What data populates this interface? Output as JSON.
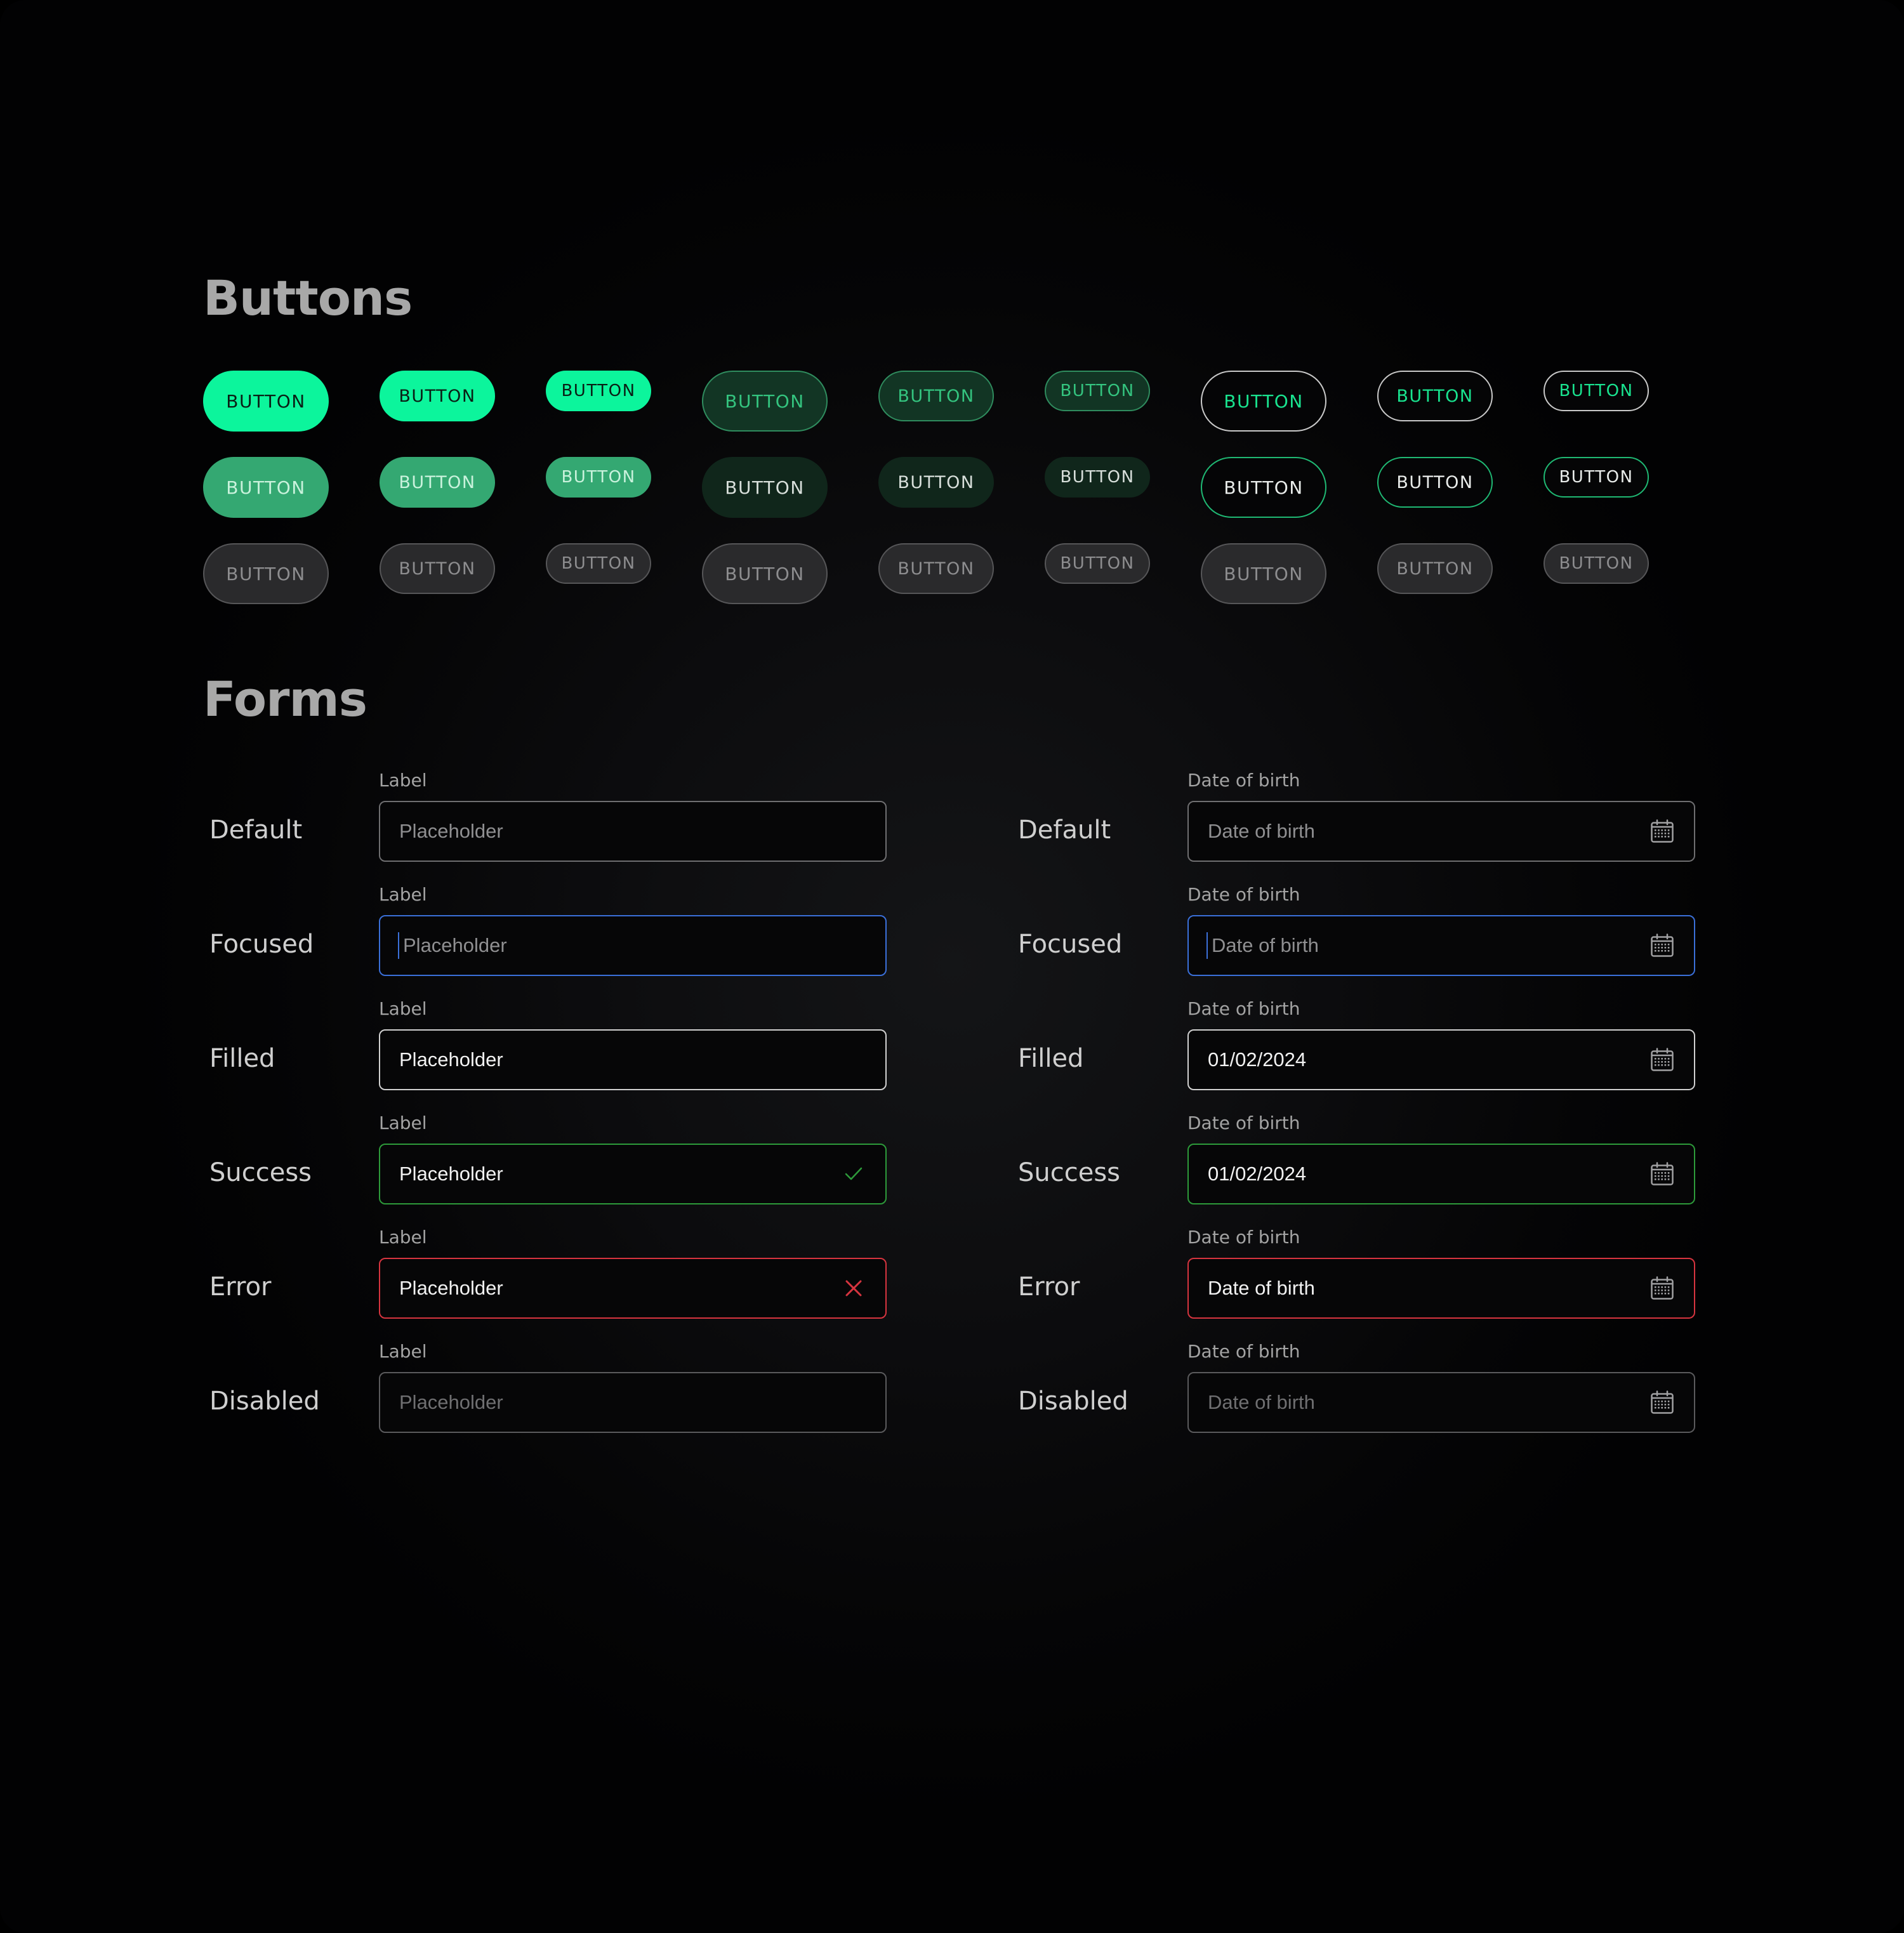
{
  "sections": {
    "buttons_title": "Buttons",
    "forms_title": "Forms"
  },
  "button_label": "BUTTON",
  "button_grid": {
    "rows": [
      [
        "solid",
        "solid",
        "solid",
        "tonal",
        "tonal",
        "tonal",
        "outline",
        "outline",
        "outline"
      ],
      [
        "solid-muted",
        "solid-muted",
        "solid-muted",
        "tonal-dark",
        "tonal-dark",
        "tonal-dark",
        "outline-green",
        "outline-green",
        "outline-green"
      ],
      [
        "disabled",
        "disabled",
        "disabled",
        "disabled",
        "disabled",
        "disabled",
        "disabled",
        "disabled",
        "disabled"
      ]
    ],
    "sizes": [
      "lg",
      "md",
      "sm",
      "lg",
      "md",
      "sm",
      "lg",
      "md",
      "sm"
    ]
  },
  "colors": {
    "primary": "#0cf59c",
    "primary_muted": "#34a872",
    "tonal": "#123524",
    "focus": "#3a6fd8",
    "success": "#2d9a3a",
    "error": "#d6343f"
  },
  "forms": {
    "states": [
      "Default",
      "Focused",
      "Filled",
      "Success",
      "Error",
      "Disabled"
    ],
    "text_field": {
      "label": "Label",
      "values": [
        "Placeholder",
        "Placeholder",
        "Placeholder",
        "Placeholder",
        "Placeholder",
        "Placeholder"
      ],
      "icons": [
        "",
        "",
        "",
        "check-icon",
        "close-icon",
        ""
      ]
    },
    "date_field": {
      "label": "Date of birth",
      "values": [
        "Date of birth",
        "Date of birth",
        "01/02/2024",
        "01/02/2024",
        "Date of birth",
        "Date of birth"
      ],
      "icon": "calendar-icon"
    }
  }
}
